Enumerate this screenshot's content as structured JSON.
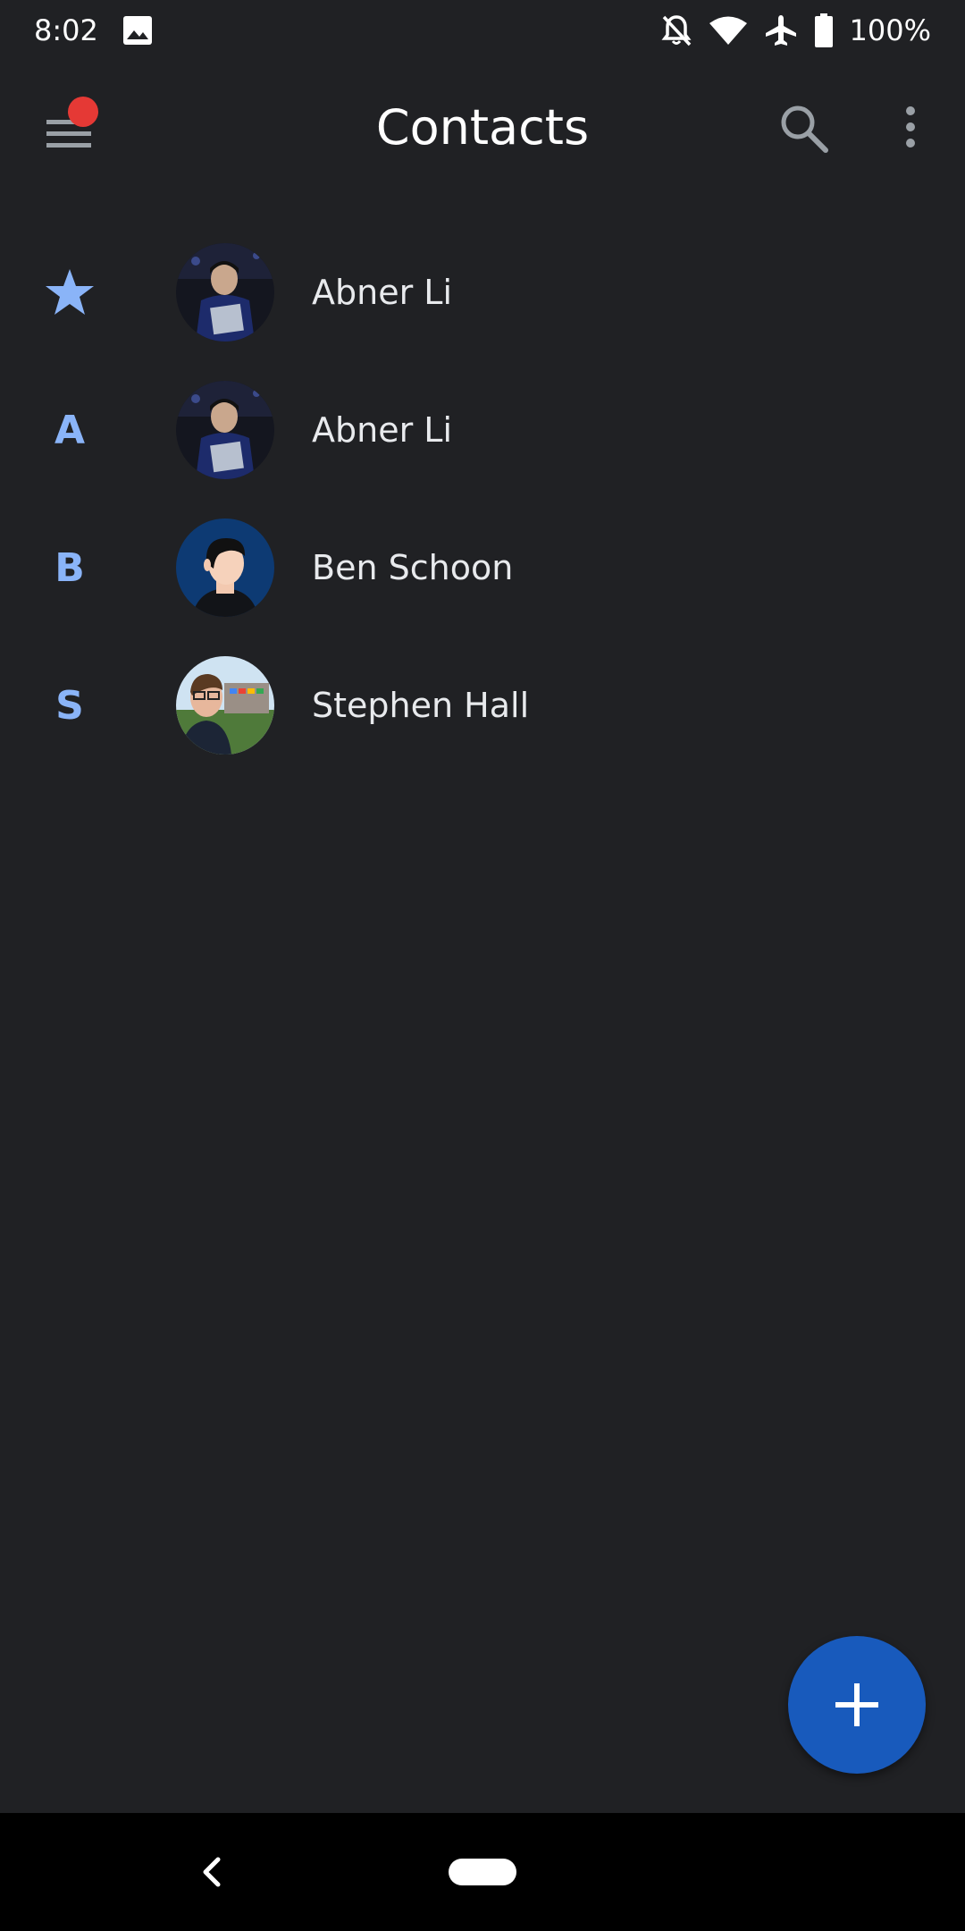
{
  "status_bar": {
    "time": "8:02",
    "battery_percent": "100%",
    "icons": [
      "gallery-icon",
      "notifications-off-icon",
      "wifi-icon",
      "airplane-mode-icon",
      "battery-icon"
    ]
  },
  "app_bar": {
    "title": "Contacts",
    "menu_icon": "hamburger-menu-icon",
    "menu_badge_color": "#e53935",
    "search_icon": "search-icon",
    "more_icon": "more-vert-icon"
  },
  "contacts": [
    {
      "section": "favorite",
      "section_icon": "star-icon",
      "name": "Abner Li",
      "avatar": "photo"
    },
    {
      "section": "A",
      "name": "Abner Li",
      "avatar": "photo"
    },
    {
      "section": "B",
      "name": "Ben Schoon",
      "avatar": "illustration"
    },
    {
      "section": "S",
      "name": "Stephen Hall",
      "avatar": "photo"
    }
  ],
  "fab": {
    "icon": "plus-icon",
    "color": "#185abc"
  },
  "nav_bar": {
    "back_icon": "back-icon",
    "home_icon": "home-pill-icon"
  },
  "colors": {
    "background": "#202124",
    "accent": "#8ab4f8",
    "text": "#e8eaed"
  }
}
